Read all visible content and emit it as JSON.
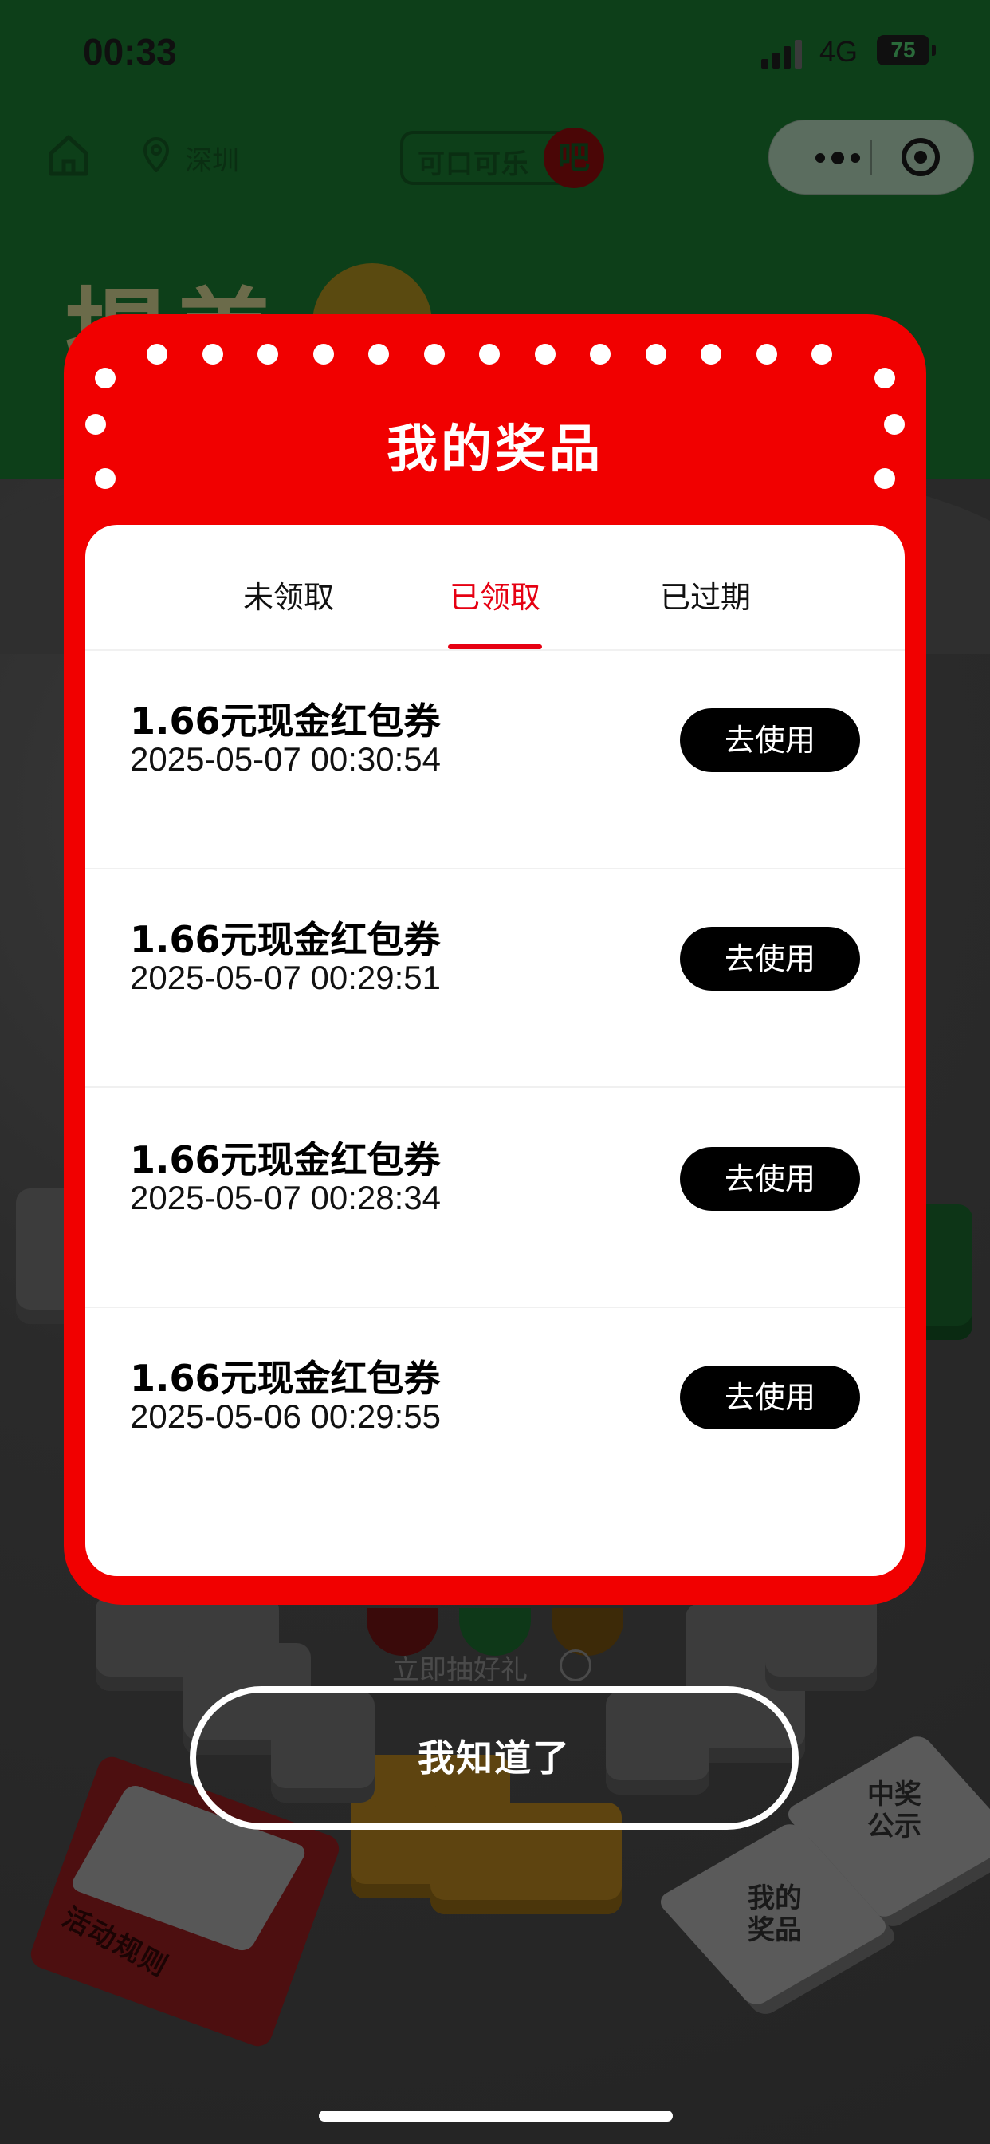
{
  "status_bar": {
    "time": "00:33",
    "network": "4G",
    "battery": "75"
  },
  "nav": {
    "city": "深圳",
    "brand_text": "可口可乐",
    "brand_badge": "吧"
  },
  "background": {
    "peek_title": "揭盖",
    "draw_hint": "立即抽好礼",
    "rules_book_label": "活动规则",
    "tile_my_prizes": "我的\n奖品",
    "tile_winners": "中奖\n公示"
  },
  "modal": {
    "title": "我的奖品",
    "tabs": [
      {
        "label": "未领取",
        "active": false
      },
      {
        "label": "已领取",
        "active": true
      },
      {
        "label": "已过期",
        "active": false
      }
    ],
    "prizes": [
      {
        "name": "1.66元现金红包券",
        "time": "2025-05-07 00:30:54",
        "action": "去使用"
      },
      {
        "name": "1.66元现金红包券",
        "time": "2025-05-07 00:29:51",
        "action": "去使用"
      },
      {
        "name": "1.66元现金红包券",
        "time": "2025-05-07 00:28:34",
        "action": "去使用"
      },
      {
        "name": "1.66元现金红包券",
        "time": "2025-05-06 00:29:55",
        "action": "去使用"
      }
    ]
  },
  "confirm_button": "我知道了",
  "colors": {
    "accent_red": "#f10000",
    "tab_active": "#e60012",
    "button_black": "#000000"
  }
}
